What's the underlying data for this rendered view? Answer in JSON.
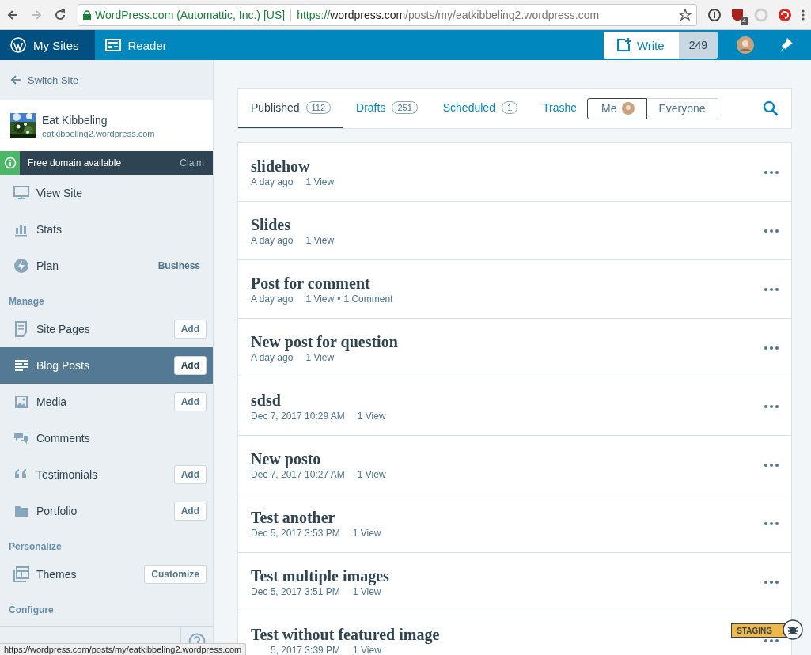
{
  "browser": {
    "site_identity": "WordPress.com (Automattic, Inc.) [US]",
    "url_scheme": "https://",
    "url_host": "wordpress.com",
    "url_path": "/posts/my/eatkibbeling2.wordpress.com",
    "extension_badge": "4"
  },
  "masterbar": {
    "tabs": [
      {
        "label": "My Sites",
        "selected": true
      },
      {
        "label": "Reader",
        "selected": false
      }
    ],
    "write": "Write",
    "count": "249"
  },
  "sidebar": {
    "switch_site": "Switch Site",
    "site": {
      "name": "Eat Kibbeling",
      "url": "eatkibbeling2.wordpress.com"
    },
    "notice": {
      "text": "Free domain available",
      "action": "Claim"
    },
    "sections": [
      {
        "items": [
          {
            "label": "View Site",
            "selected": false
          },
          {
            "label": "Stats",
            "selected": false
          },
          {
            "label": "Plan",
            "selected": false,
            "badge": "Business"
          }
        ]
      },
      {
        "title": "Manage",
        "items": [
          {
            "label": "Site Pages",
            "selected": false,
            "button": "Add"
          },
          {
            "label": "Blog Posts",
            "selected": true,
            "button": "Add"
          },
          {
            "label": "Media",
            "selected": false,
            "button": "Add"
          },
          {
            "label": "Comments",
            "selected": false
          },
          {
            "label": "Testimonials",
            "selected": false,
            "button": "Add"
          },
          {
            "label": "Portfolio",
            "selected": false,
            "button": "Add"
          }
        ]
      },
      {
        "title": "Personalize",
        "items": [
          {
            "label": "Themes",
            "selected": false,
            "button": "Customize"
          }
        ]
      },
      {
        "title": "Configure"
      }
    ]
  },
  "tabs": [
    {
      "label": "Published",
      "count": "112",
      "selected": true
    },
    {
      "label": "Drafts",
      "count": "251",
      "selected": false
    },
    {
      "label": "Scheduled",
      "count": "1",
      "selected": false
    },
    {
      "label": "Trashe",
      "selected": false
    }
  ],
  "author_filter": [
    {
      "label": "Me",
      "selected": true
    },
    {
      "label": "Everyone",
      "selected": false
    }
  ],
  "posts": [
    {
      "title": "slidehow",
      "date": "A day ago",
      "views": "1 View"
    },
    {
      "title": "Slides",
      "date": "A day ago",
      "views": "1 View"
    },
    {
      "title": "Post for comment",
      "date": "A day ago",
      "views": "1 View",
      "separator": "•",
      "comments": "1 Comment"
    },
    {
      "title": "New post for question",
      "date": "A day ago",
      "views": "1 View"
    },
    {
      "title": "sdsd",
      "date": "Dec 7, 2017 10:29 AM",
      "views": "1 View"
    },
    {
      "title": "New posto",
      "date": "Dec 7, 2017 10:27 AM",
      "views": "1 View"
    },
    {
      "title": "Test another",
      "date": "Dec 5, 2017 3:53 PM",
      "views": "1 View"
    },
    {
      "title": "Test multiple images",
      "date": "Dec 5, 2017 3:51 PM",
      "views": "1 View"
    },
    {
      "title": "Test without featured image",
      "date": "5, 2017 3:39 PM",
      "views": "1 View"
    }
  ],
  "staging": "STAGING",
  "status_url": "https://wordpress.com/posts/my/eatkibbeling2.wordpress.com"
}
